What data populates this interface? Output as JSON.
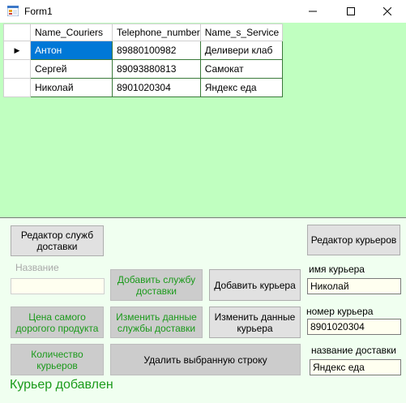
{
  "window": {
    "title": "Form1",
    "minimize_icon": "minimize-icon",
    "maximize_icon": "maximize-icon",
    "close_icon": "close-icon"
  },
  "grid": {
    "columns": [
      "Name_Couriers",
      "Telephone_number",
      "Name_s_Service"
    ],
    "rows": [
      [
        "Антон",
        "89880100982",
        "Деливери клаб"
      ],
      [
        "Сергей",
        "89093880813",
        "Самокат"
      ],
      [
        "Николай",
        "8901020304",
        "Яндекс еда"
      ]
    ],
    "current_row_marker": "▶"
  },
  "buttons": {
    "edit_services": "Редактор служб доставки",
    "edit_couriers": "Редактор курьеров",
    "add_service": "Добавить службу доставки",
    "add_courier": "Добавить курьера",
    "max_price": "Цена самого дорогого продукта",
    "edit_service": "Изменить данные службы доставки",
    "edit_courier": "Изменить данные курьера",
    "courier_count": "Количество курьеров",
    "delete_row": "Удалить выбранную строку"
  },
  "form": {
    "name_label": "Название",
    "name_value": "",
    "courier_name_label": "имя курьера",
    "courier_name_value": "Николай",
    "courier_number_label": "номер курьера",
    "courier_number_value": "8901020304",
    "delivery_name_label": "название доставки",
    "delivery_name_value": "Яндекс еда"
  },
  "status": {
    "text": "Курьер добавлен"
  }
}
